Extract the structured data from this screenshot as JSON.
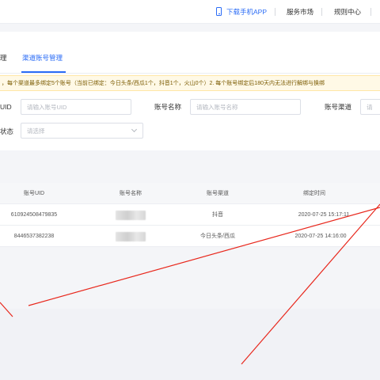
{
  "topbar": {
    "download_app": "下载手机APP",
    "service_market": "服务市场",
    "rule_center": "规则中心"
  },
  "tabs": [
    {
      "label": "理",
      "active": false
    },
    {
      "label": "渠道账号管理",
      "active": true
    }
  ],
  "notice": "，每个渠道最多绑定5个账号（当前已绑定：今日头条/西瓜1个，抖音1个，火山0个）2. 每个账号绑定后180天内无法进行解绑与换绑",
  "filters": {
    "uid_label": "UID",
    "uid_placeholder": "请输入账号UID",
    "name_label": "账号名称",
    "name_placeholder": "请输入账号名称",
    "channel_label": "账号渠道",
    "channel_placeholder": "请",
    "status_label": "状态",
    "status_placeholder": "请选择"
  },
  "table": {
    "columns": [
      "账号UID",
      "账号名称",
      "账号渠道",
      "绑定时间"
    ],
    "rows": [
      {
        "uid": "610924508479835",
        "channel": "抖音",
        "time": "2020-07-25 15:17:11"
      },
      {
        "uid": "8446537382238",
        "channel": "今日头条/西瓜",
        "time": "2020-07-25 14:16:00"
      }
    ]
  },
  "colors": {
    "accent": "#2b6cf6",
    "annotation": "#e8271c",
    "notice_bg": "#fff9e6"
  }
}
